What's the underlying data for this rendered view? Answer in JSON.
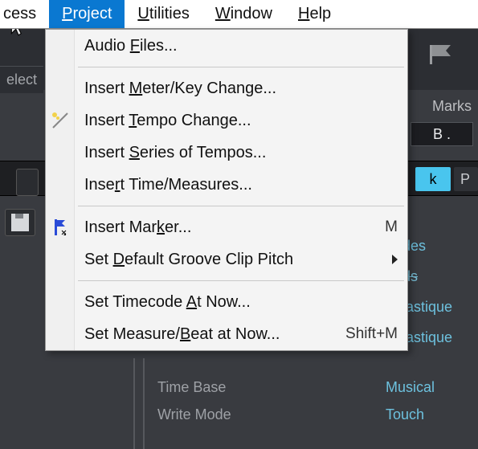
{
  "menubar": {
    "items": [
      {
        "label_html": "cess"
      },
      {
        "label_html": "[u]P[/u]roject",
        "selected": true
      },
      {
        "label_html": "[u]U[/u]tilities"
      },
      {
        "label_html": "[u]W[/u]indow"
      },
      {
        "label_html": "[u]H[/u]elp"
      }
    ]
  },
  "toolbar": {
    "select_label": "elect",
    "marks_label": "Marks",
    "spin_value": "B   .",
    "tab_k": "k",
    "tab_p": "P"
  },
  "dropdown": {
    "sections": [
      [
        {
          "label_html": "Audio [u]F[/u]iles...",
          "icon": null,
          "shortcut": "",
          "submenu": false,
          "name": "menu-audio-files"
        }
      ],
      [
        {
          "label_html": "Insert [u]M[/u]eter/Key Change...",
          "icon": null,
          "shortcut": "",
          "submenu": false,
          "name": "menu-insert-meterkey"
        },
        {
          "label_html": "Insert [u]T[/u]empo Change...",
          "icon": "tempo",
          "shortcut": "",
          "submenu": false,
          "name": "menu-insert-tempo"
        },
        {
          "label_html": "Insert [u]S[/u]eries of Tempos...",
          "icon": null,
          "shortcut": "",
          "submenu": false,
          "name": "menu-insert-tempo-series"
        },
        {
          "label_html": "Inse[u]r[/u]t Time/Measures...",
          "icon": null,
          "shortcut": "",
          "submenu": false,
          "name": "menu-insert-time"
        }
      ],
      [
        {
          "label_html": "Insert Mar[u]k[/u]er...",
          "icon": "marker",
          "shortcut": "M",
          "submenu": false,
          "name": "menu-insert-marker"
        },
        {
          "label_html": "Set [u]D[/u]efault Groove Clip Pitch",
          "icon": null,
          "shortcut": "",
          "submenu": true,
          "name": "menu-set-default-groove-pitch"
        }
      ],
      [
        {
          "label_html": "Set Timecode [u]A[/u]t Now...",
          "icon": null,
          "shortcut": "",
          "submenu": false,
          "name": "menu-set-timecode"
        },
        {
          "label_html": "Set Measure/[u]B[/u]eat at Now...",
          "icon": null,
          "shortcut": "Shift+M",
          "submenu": false,
          "name": "menu-set-measure-beat"
        }
      ]
    ]
  },
  "clip_props": {
    "visible_values": [
      "des",
      "ds",
      "lastique",
      "lastique"
    ]
  },
  "params": {
    "rows": [
      {
        "label": "Time Base",
        "value": "Musical"
      },
      {
        "label": "Write Mode",
        "value": "Touch"
      }
    ]
  }
}
